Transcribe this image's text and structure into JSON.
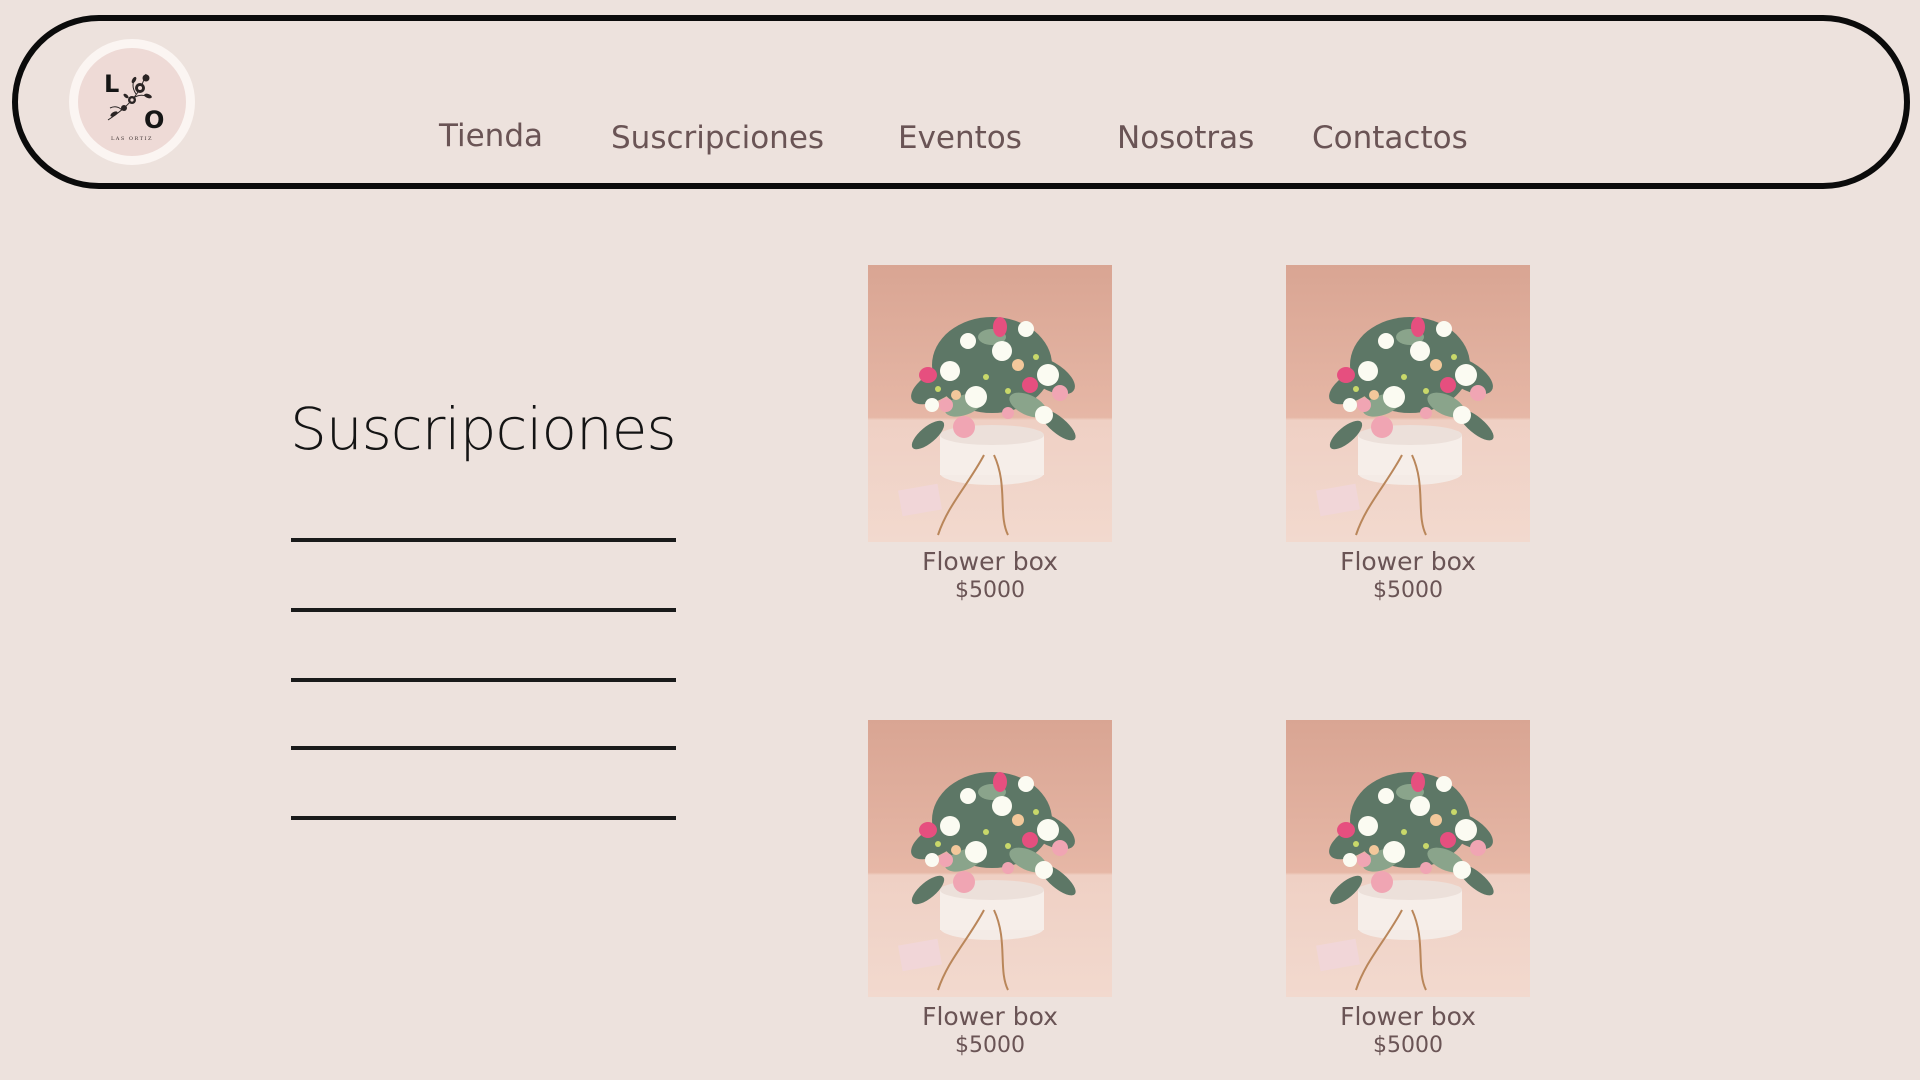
{
  "logo": {
    "letter_top": "L",
    "letter_bottom": "O",
    "brand": "LAS ORTIZ"
  },
  "nav": {
    "items": [
      {
        "label": "Tienda"
      },
      {
        "label": "Suscripciones"
      },
      {
        "label": "Eventos"
      },
      {
        "label": "Nosotras"
      },
      {
        "label": "Contactos"
      }
    ]
  },
  "panel": {
    "title": "Suscripciones",
    "filter_count": 5
  },
  "products": [
    {
      "name": "Flower box",
      "price": "$5000",
      "image": "flower-box-photo"
    },
    {
      "name": "Flower box",
      "price": "$5000",
      "image": "flower-box-photo"
    },
    {
      "name": "Flower box",
      "price": "$5000",
      "image": "flower-box-photo"
    },
    {
      "name": "Flower box",
      "price": "$5000",
      "image": "flower-box-photo"
    }
  ],
  "colors": {
    "background": "#ede2dd",
    "nav_text": "#6a5455",
    "border": "#0b0b0b"
  }
}
